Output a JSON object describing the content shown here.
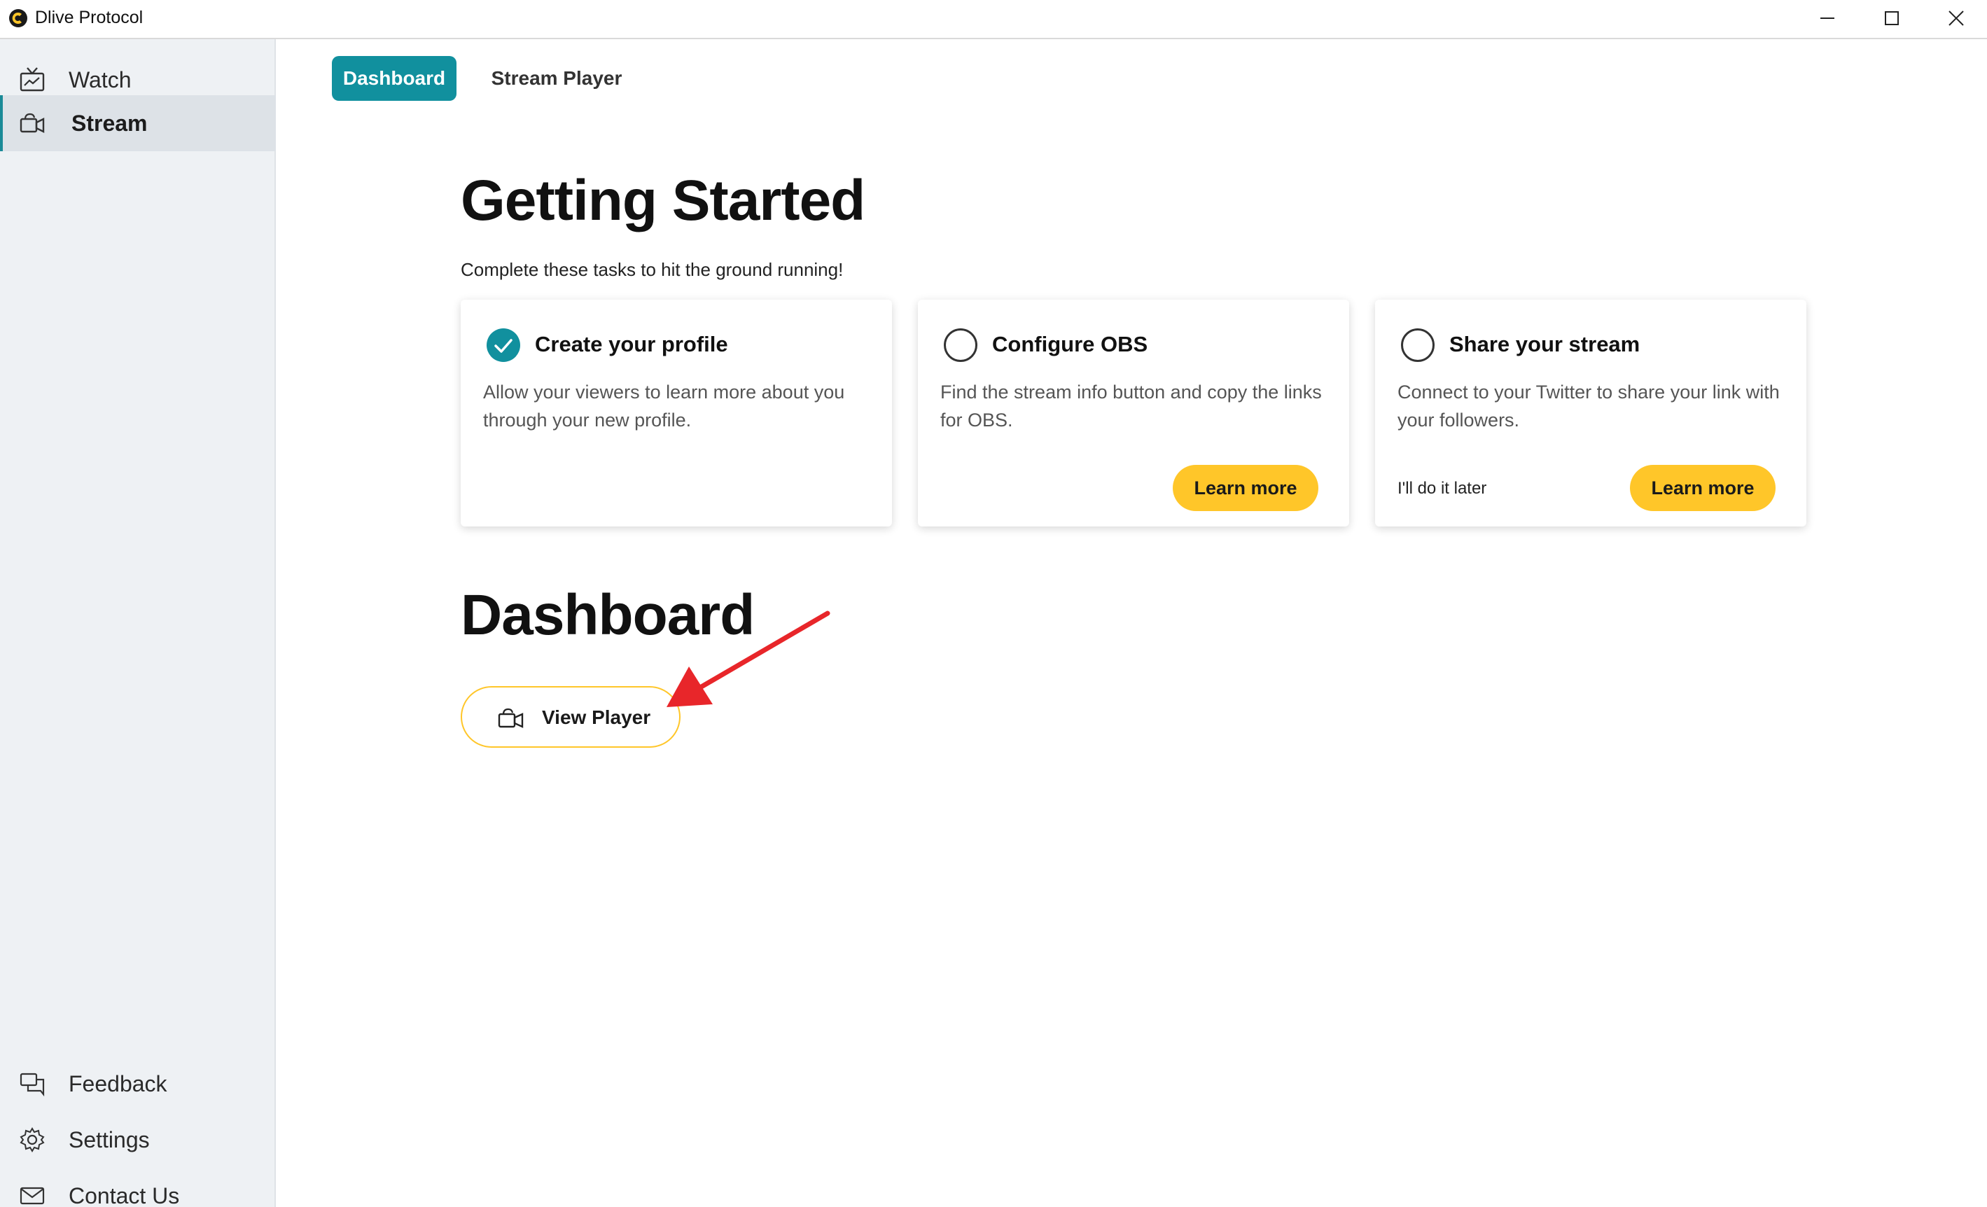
{
  "window": {
    "title": "Dlive Protocol",
    "controls": [
      "minimize",
      "maximize",
      "close"
    ]
  },
  "sidebar": {
    "items": [
      {
        "label": "Watch",
        "icon": "tv-icon",
        "active": false
      },
      {
        "label": "Stream",
        "icon": "camera-icon",
        "active": true
      }
    ],
    "bottom_items": [
      {
        "label": "Feedback",
        "icon": "chat-icon"
      },
      {
        "label": "Settings",
        "icon": "gear-icon"
      },
      {
        "label": "Contact Us",
        "icon": "mail-icon"
      }
    ]
  },
  "tabs": [
    {
      "label": "Dashboard",
      "active": true
    },
    {
      "label": "Stream Player",
      "active": false
    }
  ],
  "getting_started": {
    "title": "Getting Started",
    "subtitle": "Complete these tasks to hit the ground running!",
    "cards": [
      {
        "title": "Create your profile",
        "description": "Allow your viewers to learn more about you through your new profile.",
        "completed": true
      },
      {
        "title": "Configure OBS",
        "description": "Find the stream info button and copy the links for OBS.",
        "completed": false,
        "button": "Learn more"
      },
      {
        "title": "Share your stream",
        "description": "Connect to your Twitter to share your link with your followers.",
        "completed": false,
        "secondary": "I'll do it later",
        "button": "Learn more"
      }
    ]
  },
  "dashboard": {
    "title": "Dashboard",
    "view_player_label": "View Player"
  },
  "colors": {
    "accent_teal": "#11909e",
    "accent_yellow": "#ffc629",
    "sidebar_bg": "#eef1f4",
    "annotation_arrow": "#e8262a"
  }
}
